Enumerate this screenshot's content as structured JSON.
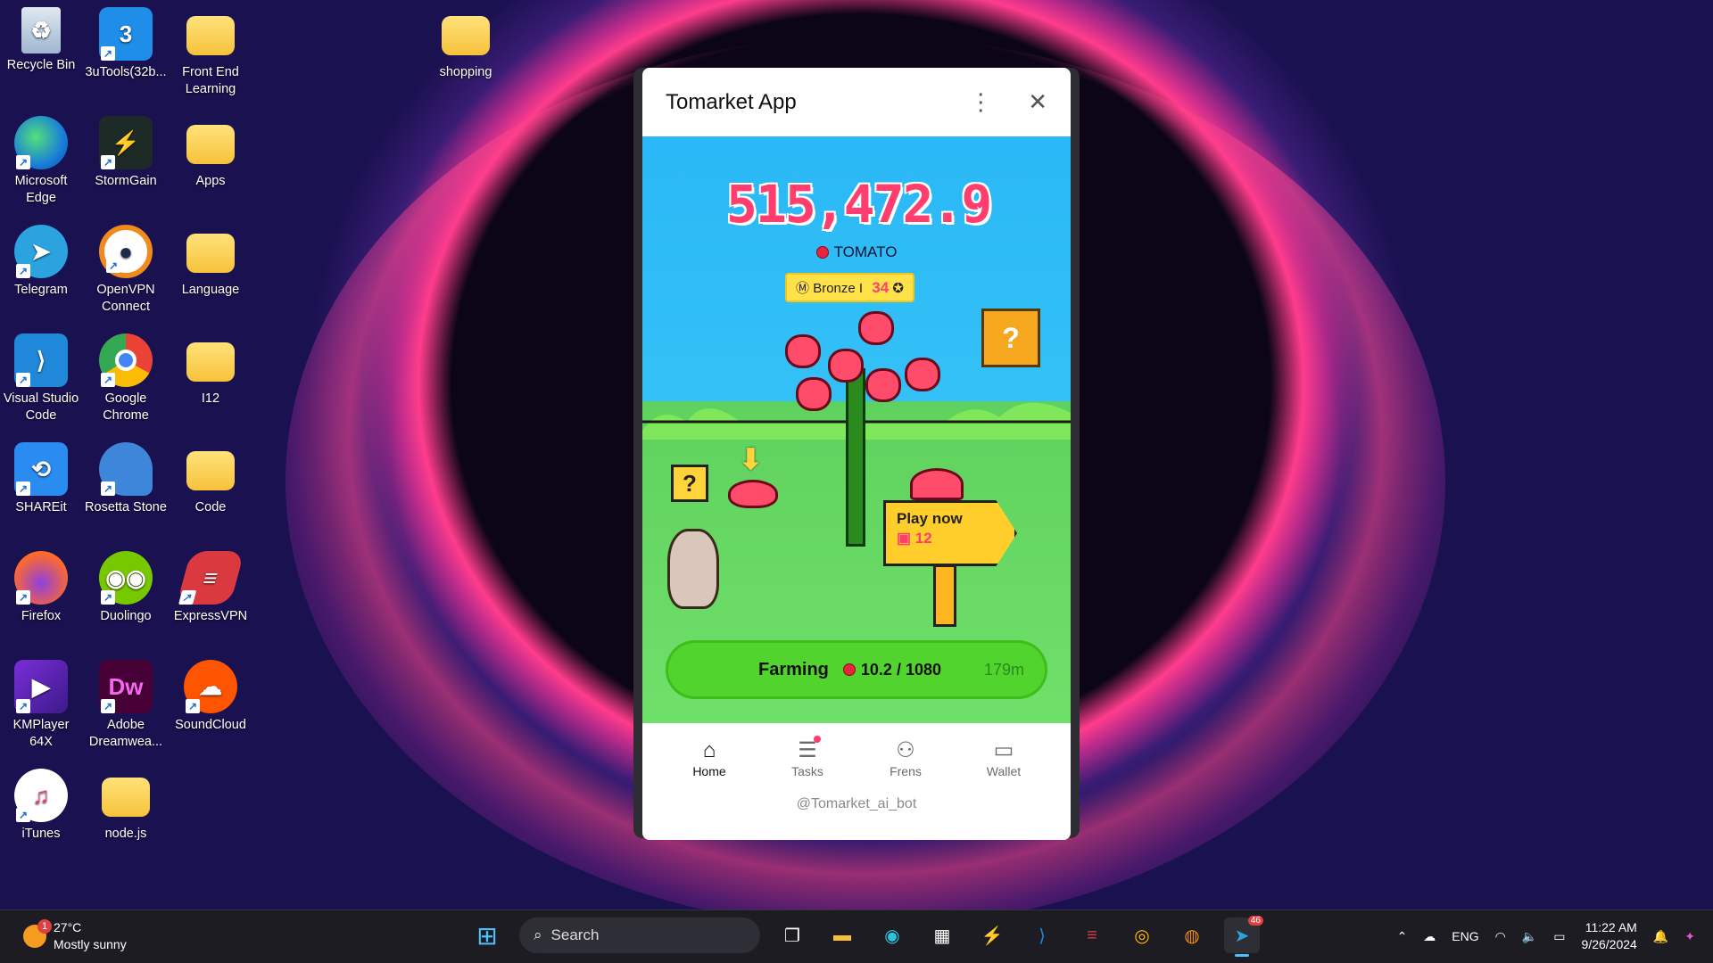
{
  "desktop": {
    "icons": [
      {
        "label": "Recycle Bin",
        "icon": "recycle-bin-icon"
      },
      {
        "label": "3uTools(32b...",
        "icon": "3utools-icon"
      },
      {
        "label": "Front End Learning",
        "icon": "folder-icon"
      },
      {
        "label": "shopping",
        "icon": "folder-icon"
      },
      {
        "label": "Microsoft Edge",
        "icon": "edge-icon"
      },
      {
        "label": "StormGain",
        "icon": "stormgain-icon"
      },
      {
        "label": "Apps",
        "icon": "folder-icon"
      },
      {
        "label": "Telegram",
        "icon": "telegram-icon"
      },
      {
        "label": "OpenVPN Connect",
        "icon": "openvpn-icon"
      },
      {
        "label": "Language",
        "icon": "folder-icon"
      },
      {
        "label": "Visual Studio Code",
        "icon": "vscode-icon"
      },
      {
        "label": "Google Chrome",
        "icon": "chrome-icon"
      },
      {
        "label": "I12",
        "icon": "folder-icon"
      },
      {
        "label": "SHAREit",
        "icon": "shareit-icon"
      },
      {
        "label": "Rosetta Stone",
        "icon": "rosetta-icon"
      },
      {
        "label": "Code",
        "icon": "folder-icon"
      },
      {
        "label": "Firefox",
        "icon": "firefox-icon"
      },
      {
        "label": "Duolingo",
        "icon": "duolingo-icon"
      },
      {
        "label": "ExpressVPN",
        "icon": "expressvpn-icon"
      },
      {
        "label": "KMPlayer 64X",
        "icon": "kmplayer-icon"
      },
      {
        "label": "Adobe Dreamwea...",
        "icon": "dreamweaver-icon"
      },
      {
        "label": "SoundCloud",
        "icon": "soundcloud-icon"
      },
      {
        "label": "iTunes",
        "icon": "itunes-icon"
      },
      {
        "label": "node.js",
        "icon": "folder-icon"
      }
    ]
  },
  "app": {
    "title": "Tomarket App",
    "balance": "515,472.9",
    "currency": "TOMATO",
    "rank": {
      "name": "Bronze I",
      "level": "34"
    },
    "mystery_box": "?",
    "question_block": "?",
    "play_sign": {
      "label": "Play now",
      "count": "12"
    },
    "farming": {
      "label": "Farming",
      "value": "10.2 / 1080",
      "time": "179m"
    },
    "tabs": [
      {
        "label": "Home",
        "icon": "home-icon"
      },
      {
        "label": "Tasks",
        "icon": "tasks-icon"
      },
      {
        "label": "Frens",
        "icon": "frens-icon"
      },
      {
        "label": "Wallet",
        "icon": "wallet-icon"
      }
    ],
    "bot_handle": "@Tomarket_ai_bot"
  },
  "taskbar": {
    "weather": {
      "temp": "27°C",
      "desc": "Mostly sunny",
      "badge": "1"
    },
    "search_placeholder": "Search",
    "telegram_badge": "46",
    "lang": "ENG",
    "time": "11:22 AM",
    "date": "9/26/2024"
  },
  "colors": {
    "accent": "#ff3d6e",
    "sky": "#34c1f7",
    "grass": "#6fe06a",
    "farming": "#52d42e"
  }
}
